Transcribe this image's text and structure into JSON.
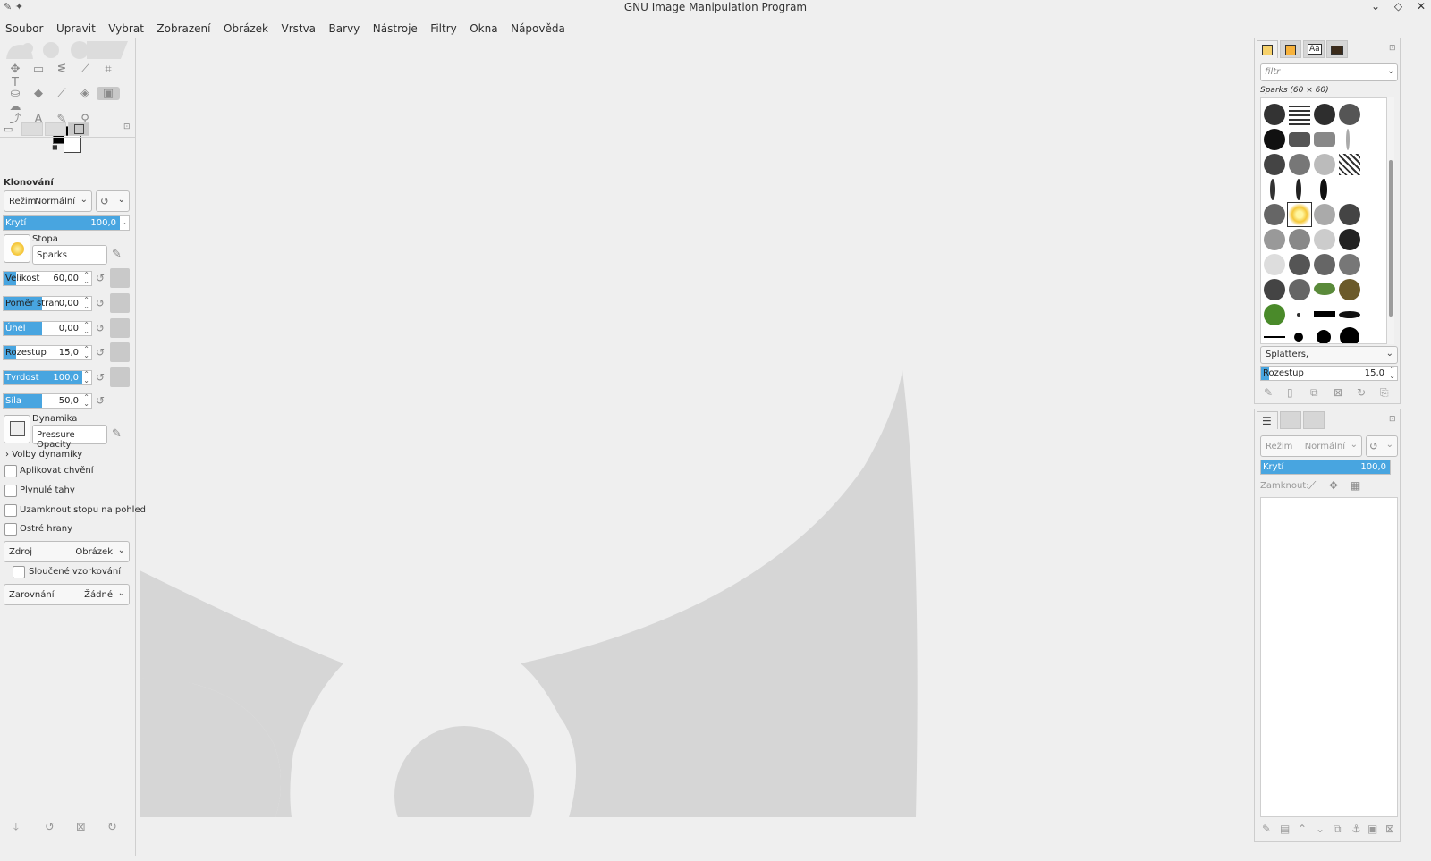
{
  "window": {
    "title": "GNU Image Manipulation Program",
    "controls": [
      "chevron-down-icon",
      "diamond-icon",
      "close-icon"
    ]
  },
  "menu": [
    "Soubor",
    "Upravit",
    "Vybrat",
    "Zobrazení",
    "Obrázek",
    "Vrstva",
    "Barvy",
    "Nástroje",
    "Filtry",
    "Okna",
    "Nápověda"
  ],
  "tool_options": {
    "title": "Klonování",
    "mode": {
      "label": "Režim",
      "value": "Normální"
    },
    "opacity": {
      "label": "Krytí",
      "value": "100,0",
      "fraction": 1.0
    },
    "brush": {
      "label": "Stopa",
      "value": "Sparks"
    },
    "size": {
      "label": "Velikost",
      "value": "60,00"
    },
    "aspect": {
      "label": "Poměr stran",
      "value": "0,00"
    },
    "angle": {
      "label": "Úhel",
      "value": "0,00"
    },
    "spacing": {
      "label": "Rozestup",
      "value": "15,0"
    },
    "hardness": {
      "label": "Tvrdost",
      "value": "100,0",
      "fraction": 1.0
    },
    "force": {
      "label": "Síla",
      "value": "50,0"
    },
    "dynamics": {
      "label": "Dynamika",
      "value": "Pressure Opacity"
    },
    "dynamics_options": "Volby dynamiky",
    "checks": [
      "Aplikovat chvění",
      "Plynulé tahy",
      "Uzamknout stopu na pohled",
      "Ostré hrany"
    ],
    "source": {
      "label": "Zdroj",
      "value": "Obrázek"
    },
    "sample_merged": "Sloučené vzorkování",
    "alignment": {
      "label": "Zarovnání",
      "value": "Žádné"
    }
  },
  "brushes": {
    "filter_placeholder": "filtr",
    "current": "Sparks (60 × 60)",
    "tag": "Splatters,",
    "spacing": {
      "label": "Rozestup",
      "value": "15,0"
    }
  },
  "layers": {
    "mode": {
      "label": "Režim",
      "value": "Normální"
    },
    "opacity": {
      "label": "Krytí",
      "value": "100,0"
    },
    "lock_label": "Zamknout:"
  },
  "colors": {
    "accent": "#48a5e0",
    "fg": "#000000",
    "bg": "#ffffff",
    "wilber": "#d6d6d6"
  }
}
